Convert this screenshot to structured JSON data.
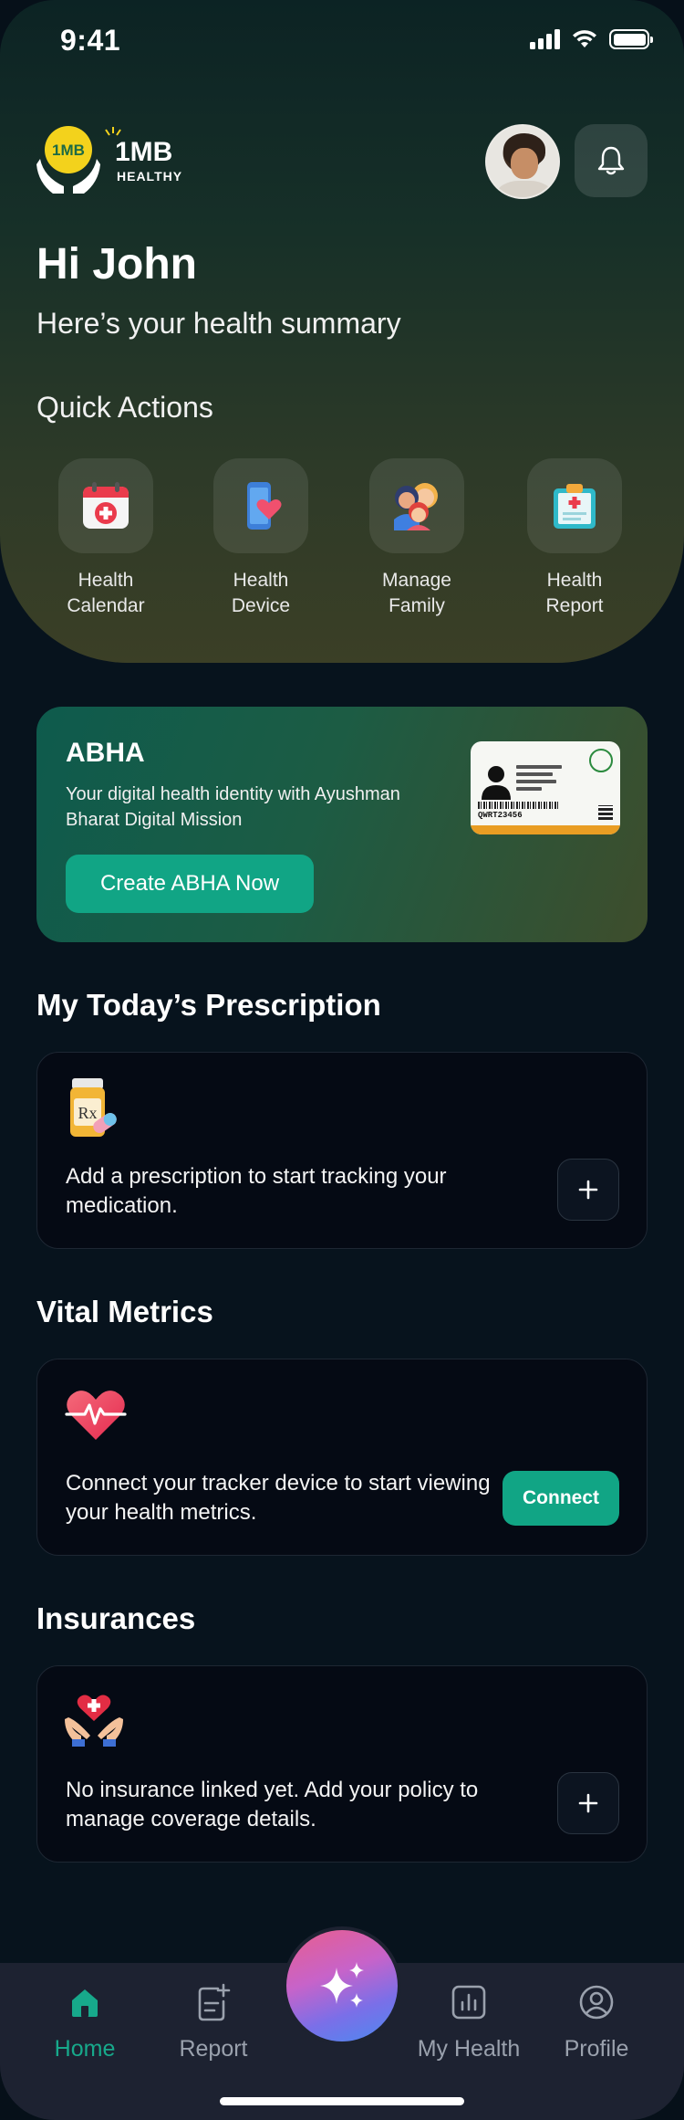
{
  "status_bar": {
    "time": "9:41"
  },
  "header": {
    "logo_text_main": "1MB",
    "logo_text_sub": "HEALTHY",
    "logo_badge": "1MB"
  },
  "greeting": "Hi John",
  "subtitle": "Here’s your health summary",
  "quick_actions": {
    "title": "Quick Actions",
    "items": [
      {
        "line1": "Health",
        "line2": "Calendar",
        "icon": "calendar-icon"
      },
      {
        "line1": "Health",
        "line2": "Device",
        "icon": "phone-heart-icon"
      },
      {
        "line1": "Manage",
        "line2": "Family",
        "icon": "family-icon"
      },
      {
        "line1": "Health",
        "line2": "Report",
        "icon": "clipboard-icon"
      }
    ]
  },
  "abha": {
    "title": "ABHA",
    "description": "Your digital health identity with Ayushman Bharat Digital Mission",
    "button": "Create ABHA Now",
    "card_id": "QWRT23456"
  },
  "prescription": {
    "title": "My Today’s Prescription",
    "message": "Add a prescription to start tracking your medication.",
    "icon": "pill-bottle-icon"
  },
  "vitals": {
    "title": "Vital Metrics",
    "message": "Connect your tracker device to start viewing your health metrics.",
    "button": "Connect",
    "icon": "heart-pulse-icon"
  },
  "insurance": {
    "title": "Insurances",
    "message": "No insurance linked yet. Add your policy to manage coverage details.",
    "icon": "hands-heart-icon"
  },
  "tabbar": {
    "home": "Home",
    "report": "Report",
    "my_health": "My Health",
    "profile": "Profile"
  },
  "colors": {
    "accent": "#11a585",
    "active_tab": "#17a98b",
    "background": "#07131d",
    "card": "#050a14"
  }
}
